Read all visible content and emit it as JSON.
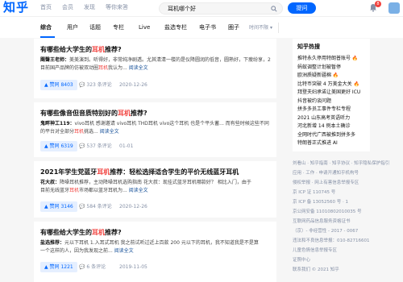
{
  "header": {
    "logo": "知乎",
    "nav": [
      "首页",
      "会员",
      "发现",
      "等你来答"
    ],
    "search_value": "耳机哪个好",
    "ask_label": "提问",
    "notification_count": "8"
  },
  "tabs": {
    "items": [
      "综合",
      "用户",
      "话题",
      "专栏",
      "Live",
      "盐选专栏",
      "电子书",
      "圈子"
    ],
    "sort_label": "时间不限"
  },
  "results": [
    {
      "title_pre": "有哪些给大学生的",
      "title_hl": "耳机",
      "title_post": "推荐?",
      "lines": [
        {
          "author": "飓聲王老师：",
          "text": "美美演到。听得好，非常纯净剧透。尤其清清一楼的是仪降圆润的低音，圆熟好，下瘦纷享，2"
        },
        {
          "author": "",
          "text": "目前国产品牌的仿被双动圈",
          "hl": "耳机",
          "post": "我认为... ",
          "more": "阅读全文"
        }
      ],
      "votes": "赞同 8403",
      "comments": "323 条评论",
      "date": "2020-12-26"
    },
    {
      "title_pre": "有哪些像音但音质特别好的",
      "title_hl": "耳机",
      "title_post": "推荐?",
      "lines": [
        {
          "author": "鬼畔神工119：",
          "text": "vivo耳机 感谢邀请 vivo耳机 THD耳机 vivo这个耳机 也是个平头蓄... 而有些时候这些不同"
        },
        {
          "author": "",
          "text": "的平台对全部分",
          "hl": "耳机",
          "post": "挑选... ",
          "more": "阅读全文"
        }
      ],
      "votes": "赞同 6319",
      "comments": "537 条评论",
      "date": "01-01"
    },
    {
      "title_pre": "2021年学生党蓝牙",
      "title_hl": "耳机",
      "title_post": "推荐：轻松选择适合学生的平价无线蓝牙耳机",
      "lines": [
        {
          "author": "花大叔：",
          "text": "降噪耳机推荐，主动降噪耳机选购指南 花大叔：现挂式蓝牙耳机哪款好？ 相比入门，由于"
        },
        {
          "author": "",
          "text": "目前无线蓝牙",
          "hl": "耳机",
          "post": "市场都以蓝牙耳机为... ",
          "more": "阅读全文"
        }
      ],
      "votes": "赞同 3146",
      "comments": "584 条评论",
      "date": "2020-12-26"
    },
    {
      "title_pre": "有哪些给大学生的",
      "title_hl": "耳机",
      "title_post": "推荐?",
      "lines": [
        {
          "author": "盐选推荐：",
          "text": "元以下耳机 1.入耳式耳机 我之前试听过近上百款 200 元以下的耳机，我不知道我是不是算"
        },
        {
          "author": "",
          "text": "一个这样的人，因为我发现之前... ",
          "hl": "",
          "post": "",
          "more": "阅读全文"
        }
      ],
      "votes": "赞同 1221",
      "comments": "6 条评论",
      "date": "2019-11-05"
    }
  ],
  "sidebar": {
    "title": "知乎热搜",
    "items": [
      {
        "text": "推特永久停用特朗普账号",
        "fire": true
      },
      {
        "text": "蚂蚁调整计划被暂停",
        "fire": false
      },
      {
        "text": "欧洲质疑新疆棉",
        "fire": true
      },
      {
        "text": "比特币突破 4 万美金大关",
        "fire": true
      },
      {
        "text": "拜登夫妇承诺让美国更好 ICU",
        "fire": false
      },
      {
        "text": "抖音被约谈问题",
        "fire": false
      },
      {
        "text": "拼多多员工事件专栏专程",
        "fire": false
      },
      {
        "text": "2021 山东高考英语听力",
        "fire": false
      },
      {
        "text": "河北新增 14 例本土确诊",
        "fire": false
      },
      {
        "text": "全网时代广西被推到拼多多",
        "fire": false
      },
      {
        "text": "特朗普正式推进 AI",
        "fire": false
      }
    ]
  },
  "footer": [
    "刘看山 · 知乎指南 · 知乎协议 · 知乎隐私保护指引",
    "应用 · 工作 · 申请开通知乎机构号",
    "侵权举报 · 网上有害信息举报专区",
    "京 ICP 证 110745 号",
    "京 ICP 备 13052560 号 · 1",
    "京公网安备 11010802010035 号",
    "互联网药品信息服务资格证书",
    "（京）- 非经营性 - 2017 - 0067",
    "违法和不良信息举报：010-82716601",
    "儿童色情信息举报专区",
    "证照中心",
    "联系我们 © 2021 知乎"
  ],
  "colors": {
    "brand": "#0066ff",
    "highlight": "#f1403c"
  }
}
